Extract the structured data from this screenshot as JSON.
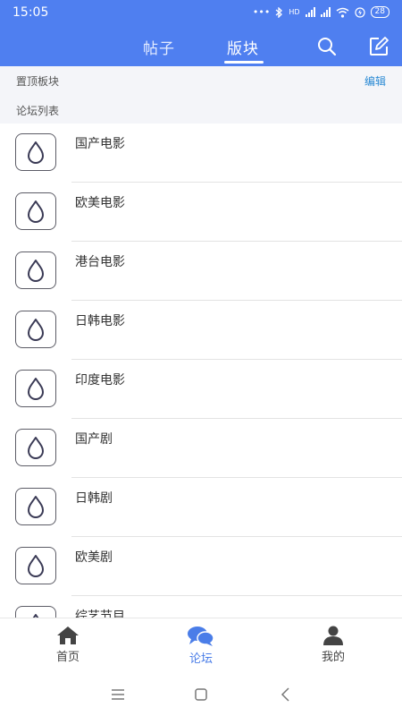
{
  "status_bar": {
    "time": "15:05",
    "dots": "•••",
    "network_label": "HD",
    "battery": "28"
  },
  "header": {
    "tabs": [
      {
        "label": "帖子",
        "active": false
      },
      {
        "label": "版块",
        "active": true
      }
    ],
    "icons": [
      "search-icon",
      "edit-icon"
    ],
    "accent_color": "#4f7ff0"
  },
  "pinned_section": {
    "label": "置顶板块",
    "edit_label": "编辑"
  },
  "forum_section": {
    "label": "论坛列表"
  },
  "forums": [
    {
      "name": "国产电影"
    },
    {
      "name": "欧美电影"
    },
    {
      "name": "港台电影"
    },
    {
      "name": "日韩电影"
    },
    {
      "name": "印度电影"
    },
    {
      "name": "国产剧"
    },
    {
      "name": "日韩剧"
    },
    {
      "name": "欧美剧"
    },
    {
      "name": "综艺节目"
    }
  ],
  "bottom_nav": {
    "items": [
      {
        "label": "首页",
        "icon": "home-icon",
        "active": false
      },
      {
        "label": "论坛",
        "icon": "chat-bubbles-icon",
        "active": true
      },
      {
        "label": "我的",
        "icon": "person-icon",
        "active": false
      }
    ],
    "active_color": "#4a7de8"
  },
  "system_nav": {
    "icons": [
      "menu-icon",
      "square-home-icon",
      "back-chevron-icon"
    ]
  }
}
